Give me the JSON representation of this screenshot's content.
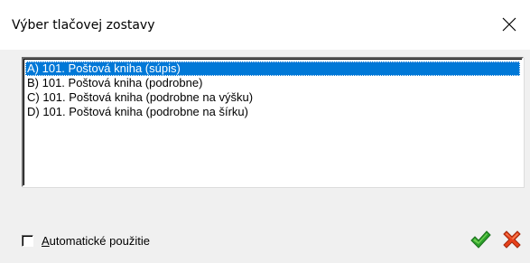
{
  "window": {
    "title": "Výber tlačovej zostavy"
  },
  "report_list": {
    "items": [
      {
        "label": "A) 101. Poštová kniha (súpis)",
        "selected": true
      },
      {
        "label": "B) 101. Poštová kniha (podrobne)",
        "selected": false
      },
      {
        "label": "C) 101. Poštová kniha (podrobne na výšku)",
        "selected": false
      },
      {
        "label": "D) 101. Poštová kniha (podrobne na šírku)",
        "selected": false
      }
    ]
  },
  "auto_use": {
    "accel": "A",
    "rest": "utomatické použitie",
    "checked": false
  },
  "buttons": {
    "ok_icon": "green-checkmark-icon",
    "cancel_icon": "red-x-icon"
  },
  "colors": {
    "selection": "#0078d7",
    "ok_green": "#2ca02c",
    "cancel_red": "#e8401a"
  }
}
